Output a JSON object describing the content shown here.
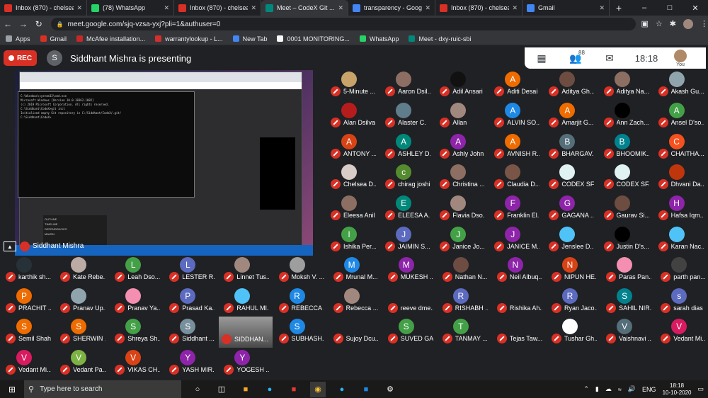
{
  "browser": {
    "tabs": [
      {
        "label": "Inbox (870) - chelseade...",
        "fav": "#d93025",
        "active": false
      },
      {
        "label": "(78) WhatsApp",
        "fav": "#25d366",
        "active": false
      },
      {
        "label": "Inbox (870) - chelseade...",
        "fav": "#d93025",
        "active": false
      },
      {
        "label": "Meet – CodeX Git ...",
        "fav": "#00897b",
        "active": true
      },
      {
        "label": "transparency - Google ...",
        "fav": "#4285f4",
        "active": false
      },
      {
        "label": "Inbox (870) - chelseade...",
        "fav": "#d93025",
        "active": false
      },
      {
        "label": "Gmail",
        "fav": "#4285f4",
        "active": false
      }
    ],
    "new_tab": "+",
    "url": "meet.google.com/sjq-vzsa-yxj?pli=1&authuser=0",
    "bookmarks": [
      {
        "label": "Apps",
        "color": "#9aa0a6"
      },
      {
        "label": "Gmail",
        "color": "#d93025"
      },
      {
        "label": "McAfee installation...",
        "color": "#c62828"
      },
      {
        "label": "warrantylookup - L...",
        "color": "#d32f2f"
      },
      {
        "label": "New Tab",
        "color": "#4285f4"
      },
      {
        "label": "0001 MONITORING...",
        "color": "#f9f9f9"
      },
      {
        "label": "WhatsApp",
        "color": "#25d366"
      },
      {
        "label": "Meet - dxy-ruic-sbi",
        "color": "#00897b"
      }
    ]
  },
  "meet": {
    "rec_label": "REC",
    "presenter_initial": "S",
    "presenting_text": "Siddhant Mishra is presenting",
    "participant_count": "88",
    "time": "18:18",
    "you_label": "You",
    "presentation_name": "Siddhant Mishra"
  },
  "participants": [
    {
      "name": "5-Minute ...",
      "initial": "",
      "color": "#c8a46a"
    },
    {
      "name": "Aaron Dsil...",
      "initial": "",
      "color": "#8d6e63"
    },
    {
      "name": "Adil Ansari",
      "initial": "",
      "color": "#111111"
    },
    {
      "name": "Aditi Desai",
      "initial": "A",
      "color": "#ef6c00"
    },
    {
      "name": "Aditya Gh...",
      "initial": "",
      "color": "#6d4c41"
    },
    {
      "name": "Aditya Na...",
      "initial": "",
      "color": "#8d6e63"
    },
    {
      "name": "Akash Gu...",
      "initial": "",
      "color": "#90a4ae"
    },
    {
      "name": "Alan Dsilva",
      "initial": "",
      "color": "#b71c1c"
    },
    {
      "name": "Alaster C.",
      "initial": "",
      "color": "#607d8b"
    },
    {
      "name": "Allan",
      "initial": "",
      "color": "#a1887f"
    },
    {
      "name": "ALVIN SO...",
      "initial": "A",
      "color": "#1e88e5"
    },
    {
      "name": "Amarjit G...",
      "initial": "A",
      "color": "#ef6c00"
    },
    {
      "name": "Ann Zach...",
      "initial": "",
      "color": "#000000"
    },
    {
      "name": "Ansel D'so...",
      "initial": "A",
      "color": "#43a047"
    },
    {
      "name": "ANTONY ...",
      "initial": "A",
      "color": "#d84315"
    },
    {
      "name": "ASHLEY D...",
      "initial": "A",
      "color": "#00897b"
    },
    {
      "name": "Ashly John",
      "initial": "A",
      "color": "#8e24aa"
    },
    {
      "name": "AVNISH R...",
      "initial": "A",
      "color": "#ef6c00"
    },
    {
      "name": "BHARGAV...",
      "initial": "B",
      "color": "#546e7a"
    },
    {
      "name": "BHOOMIK...",
      "initial": "B",
      "color": "#00838f"
    },
    {
      "name": "CHAITHA...",
      "initial": "C",
      "color": "#f4511e"
    },
    {
      "name": "Chelsea D...",
      "initial": "",
      "color": "#d7ccc8"
    },
    {
      "name": "chirag joshi",
      "initial": "c",
      "color": "#558b2f"
    },
    {
      "name": "Christina ...",
      "initial": "",
      "color": "#8d6e63"
    },
    {
      "name": "Claudia D...",
      "initial": "",
      "color": "#795548"
    },
    {
      "name": "CODEX SF...",
      "initial": "",
      "color": "#e0f2f1"
    },
    {
      "name": "CODEX SF...",
      "initial": "",
      "color": "#e0f2f1"
    },
    {
      "name": "Dhvani Da...",
      "initial": "",
      "color": "#bf360c"
    },
    {
      "name": "Eleesa Anil",
      "initial": "",
      "color": "#8d6e63"
    },
    {
      "name": "ELEESA A...",
      "initial": "E",
      "color": "#00897b"
    },
    {
      "name": "Flavia Dso...",
      "initial": "",
      "color": "#a1887f"
    },
    {
      "name": "Franklin El...",
      "initial": "F",
      "color": "#8e24aa"
    },
    {
      "name": "GAGANA ...",
      "initial": "G",
      "color": "#8e24aa"
    },
    {
      "name": "Gaurav Si...",
      "initial": "",
      "color": "#6d4c41"
    },
    {
      "name": "Hafsa Iqm...",
      "initial": "H",
      "color": "#8e24aa"
    },
    {
      "name": "Ishika Per...",
      "initial": "I",
      "color": "#43a047"
    },
    {
      "name": "JAIMIN S...",
      "initial": "J",
      "color": "#5c6bc0"
    },
    {
      "name": "Janice Jo...",
      "initial": "J",
      "color": "#43a047"
    },
    {
      "name": "JANICE M...",
      "initial": "J",
      "color": "#8e24aa"
    },
    {
      "name": "Jenslee D...",
      "initial": "",
      "color": "#4fc3f7"
    },
    {
      "name": "Justin D's...",
      "initial": "",
      "color": "#000000"
    },
    {
      "name": "Karan Nac...",
      "initial": "",
      "color": "#4fc3f7"
    },
    {
      "name": "karthik sh...",
      "initial": "",
      "color": "#263238"
    },
    {
      "name": "Kate Rebe...",
      "initial": "",
      "color": "#bcaaa4"
    },
    {
      "name": "Leah Dso...",
      "initial": "L",
      "color": "#43a047"
    },
    {
      "name": "LESTER R...",
      "initial": "L",
      "color": "#5c6bc0"
    },
    {
      "name": "Linnet Tus...",
      "initial": "",
      "color": "#a1887f"
    },
    {
      "name": "Moksh V. ...",
      "initial": "",
      "color": "#9e9e9e"
    },
    {
      "name": "Mrunal M...",
      "initial": "M",
      "color": "#1e88e5"
    },
    {
      "name": "MUKESH ...",
      "initial": "M",
      "color": "#8e24aa"
    },
    {
      "name": "Nathan N...",
      "initial": "",
      "color": "#6d4c41"
    },
    {
      "name": "Neil Albuq...",
      "initial": "N",
      "color": "#8e24aa"
    },
    {
      "name": "NIPUN HE...",
      "initial": "N",
      "color": "#d84315"
    },
    {
      "name": "Paras Pan...",
      "initial": "",
      "color": "#f48fb1"
    },
    {
      "name": "parth pan...",
      "initial": "",
      "color": "#424242"
    },
    {
      "name": "PRACHIT ...",
      "initial": "P",
      "color": "#ef6c00"
    },
    {
      "name": "Pranav Up...",
      "initial": "",
      "color": "#90a4ae"
    },
    {
      "name": "Pranav Ya...",
      "initial": "",
      "color": "#f48fb1"
    },
    {
      "name": "Prasad Ka...",
      "initial": "P",
      "color": "#5c6bc0"
    },
    {
      "name": "RAHUL MI...",
      "initial": "",
      "color": "#4fc3f7"
    },
    {
      "name": "REBECCA ...",
      "initial": "R",
      "color": "#1e88e5"
    },
    {
      "name": "Rebecca ...",
      "initial": "",
      "color": "#a1887f"
    },
    {
      "name": "reeve dme...",
      "initial": "",
      "color": "#202124"
    },
    {
      "name": "RISHABH ...",
      "initial": "R",
      "color": "#5c6bc0"
    },
    {
      "name": "Rishika Ah...",
      "initial": "",
      "color": "#202124"
    },
    {
      "name": "Ryan Jaco...",
      "initial": "R",
      "color": "#5c6bc0"
    },
    {
      "name": "SAHIL NIR...",
      "initial": "S",
      "color": "#00838f"
    },
    {
      "name": "sarah dias",
      "initial": "s",
      "color": "#5c6bc0"
    },
    {
      "name": "Semil Shah",
      "initial": "S",
      "color": "#ef6c00"
    },
    {
      "name": "SHERWIN ...",
      "initial": "S",
      "color": "#ef6c00"
    },
    {
      "name": "Shreya Sh...",
      "initial": "S",
      "color": "#43a047"
    },
    {
      "name": "Siddhant ...",
      "initial": "S",
      "color": "#78909c"
    },
    {
      "name": "SUBHASH...",
      "initial": "S",
      "color": "#1e88e5"
    },
    {
      "name": "Sujoy Dcu...",
      "initial": "",
      "color": "#202124"
    },
    {
      "name": "SUVED GA...",
      "initial": "S",
      "color": "#43a047"
    },
    {
      "name": "TANMAY ...",
      "initial": "T",
      "color": "#43a047"
    },
    {
      "name": "Tejas Taw...",
      "initial": "",
      "color": "#202124"
    },
    {
      "name": "Tushar Gh...",
      "initial": "",
      "color": "#ffffff"
    },
    {
      "name": "Vaishnavi ...",
      "initial": "V",
      "color": "#546e7a"
    },
    {
      "name": "Vedant Mi...",
      "initial": "V",
      "color": "#d81b60"
    },
    {
      "name": "Vedant Mi...",
      "initial": "V",
      "color": "#d81b60"
    },
    {
      "name": "Vedant Pa...",
      "initial": "V",
      "color": "#7cb342"
    },
    {
      "name": "VIKAS CH...",
      "initial": "V",
      "color": "#d84315"
    },
    {
      "name": "YASH MIR...",
      "initial": "Y",
      "color": "#8e24aa"
    },
    {
      "name": "YOGESH ...",
      "initial": "Y",
      "color": "#8e24aa"
    }
  ],
  "big_participant": {
    "name": "SIDDHAN..."
  },
  "presentation_cmd": [
    "C:\\Windows\\system32\\cmd.exe",
    "Microsoft Windows [Version 10.0.18362.1082]",
    "(c) 2019 Microsoft Corporation. All rights reserved.",
    "C:\\Siddhant\\CodeX>git init",
    "Initialized empty Git repository in C:/Siddhant/CodeX/.git/",
    "C:\\Siddhant\\CodeX>"
  ],
  "presentation_panel": [
    "OUTLINE",
    "TIMELINE",
    "DEPENDENCIES",
    "MAVEN"
  ],
  "taskbar": {
    "search_placeholder": "Type here to search",
    "lang": "ENG",
    "time": "18:18",
    "date": "10-10-2020"
  }
}
